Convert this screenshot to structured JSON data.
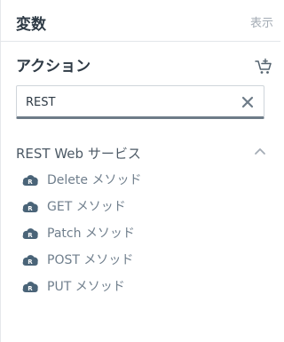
{
  "header": {
    "title": "変数",
    "show_label": "表示"
  },
  "actions": {
    "title": "アクション",
    "cart_icon": "cart-plus-icon"
  },
  "search": {
    "value": "REST",
    "placeholder": ""
  },
  "group": {
    "label": "REST Web サービス",
    "expanded": true,
    "items": [
      {
        "label": "Delete メソッド",
        "icon": "rest-cloud-icon"
      },
      {
        "label": "GET メソッド",
        "icon": "rest-cloud-icon"
      },
      {
        "label": "Patch メソッド",
        "icon": "rest-cloud-icon"
      },
      {
        "label": "POST メソッド",
        "icon": "rest-cloud-icon"
      },
      {
        "label": "PUT メソッド",
        "icon": "rest-cloud-icon"
      }
    ]
  },
  "colors": {
    "heading": "#2e3a45",
    "muted": "#a4acb5",
    "item_text": "#6f7e8c",
    "icon": "#4a6478"
  }
}
